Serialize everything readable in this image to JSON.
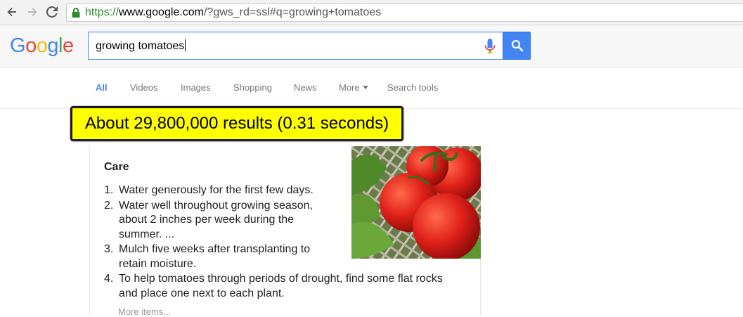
{
  "browser": {
    "url_scheme": "https://",
    "url_host": "www.google.com",
    "url_path": "/?gws_rd=ssl#q=growing+tomatoes"
  },
  "header": {
    "logo_text": "Google",
    "search_query": "growing tomatoes"
  },
  "tabs": [
    {
      "label": "All",
      "active": true
    },
    {
      "label": "Videos"
    },
    {
      "label": "Images"
    },
    {
      "label": "Shopping"
    },
    {
      "label": "News"
    },
    {
      "label": "More"
    },
    {
      "label": "Search tools"
    }
  ],
  "result_stats": "About 29,800,000 results (0.31 seconds)",
  "snippet": {
    "title": "Care",
    "steps": [
      {
        "num": "1.",
        "text": "Water generously for the first few days."
      },
      {
        "num": "2.",
        "text": "Water well throughout growing season, about 2 inches per week during the summer. ..."
      },
      {
        "num": "3.",
        "text": "Mulch five weeks after transplanting to retain moisture."
      },
      {
        "num": "4.",
        "text": "To help tomatoes through periods of drought, find some flat rocks and place one next to each plant."
      }
    ],
    "more_label": "More items..."
  },
  "colors": {
    "google_blue": "#4285f4",
    "highlight_yellow": "#ffff00"
  }
}
